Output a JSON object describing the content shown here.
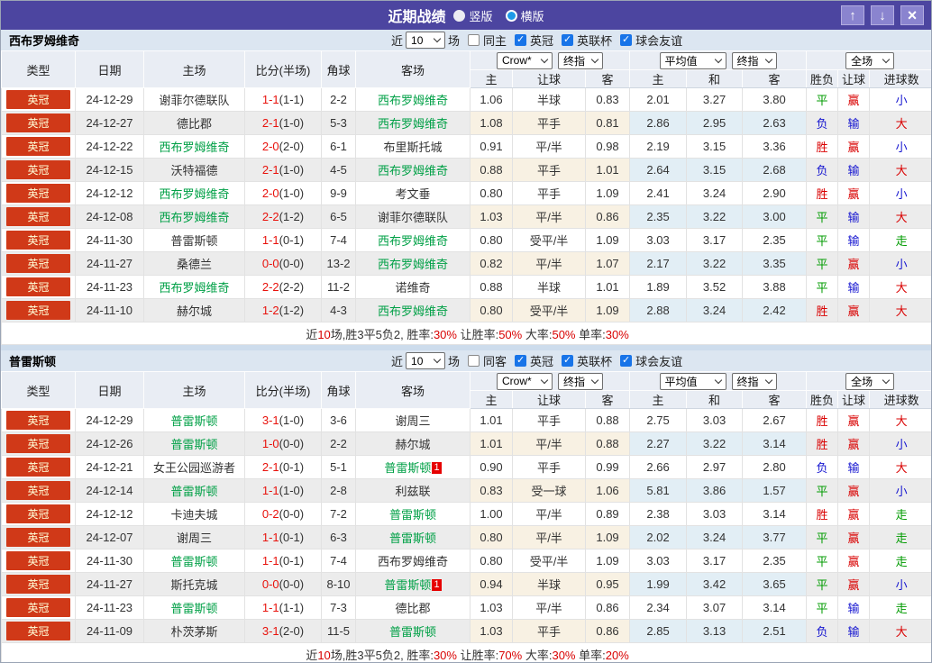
{
  "colors": {
    "titlebar": "#4c45a0",
    "league_badge_bg": "#d03918",
    "self_team_green": "#00a046",
    "score_red": "#e8120c",
    "win_red": "#d90000",
    "draw_green": "#009b00",
    "lose_blue": "#1515d0"
  },
  "titlebar": {
    "title": "近期战绩",
    "radio_vertical": "竖版",
    "radio_horizontal": "横版",
    "up_button": "↑",
    "down_button": "↓",
    "close_button": "×"
  },
  "cols": {
    "type": "类型",
    "date": "日期",
    "home": "主场",
    "score": "比分(半场)",
    "corner": "角球",
    "away": "客场",
    "h": "主",
    "handicap": "让球",
    "a": "客",
    "avg_h": "主",
    "avg_d": "和",
    "avg_a": "客",
    "outcome": "胜负",
    "asian": "让球",
    "goals": "进球数"
  },
  "selects": {
    "company": "Crow*",
    "final": "终指",
    "avg": "平均值",
    "final2": "终指",
    "scope": "全场"
  },
  "sections": [
    {
      "team": "西布罗姆维奇",
      "filter": {
        "near": "近",
        "games": "10",
        "games_suffix": "场",
        "same_label": "同主",
        "leagues": [
          "英冠",
          "英联杯",
          "球会友谊"
        ],
        "check_glyph": "✓"
      },
      "rows": [
        {
          "league": "英冠",
          "date": "24-12-29",
          "home": "谢菲尔德联队",
          "home_self": false,
          "score": "1-1",
          "half": "(1-1)",
          "corners": "2-2",
          "away": "西布罗姆维奇",
          "away_self": true,
          "away_badge": "",
          "crow": [
            "1.06",
            "半球",
            "0.83"
          ],
          "avg": [
            "2.01",
            "3.27",
            "3.80"
          ],
          "results": [
            {
              "t": "平",
              "c": "g"
            },
            {
              "t": "赢",
              "c": "r"
            },
            {
              "t": "小",
              "c": "b"
            }
          ]
        },
        {
          "league": "英冠",
          "date": "24-12-27",
          "home": "德比郡",
          "home_self": false,
          "score": "2-1",
          "half": "(1-0)",
          "corners": "5-3",
          "away": "西布罗姆维奇",
          "away_self": true,
          "away_badge": "",
          "crow": [
            "1.08",
            "平手",
            "0.81"
          ],
          "avg": [
            "2.86",
            "2.95",
            "2.63"
          ],
          "results": [
            {
              "t": "负",
              "c": "b"
            },
            {
              "t": "输",
              "c": "b"
            },
            {
              "t": "大",
              "c": "r"
            }
          ]
        },
        {
          "league": "英冠",
          "date": "24-12-22",
          "home": "西布罗姆维奇",
          "home_self": true,
          "score": "2-0",
          "half": "(2-0)",
          "corners": "6-1",
          "away": "布里斯托城",
          "away_self": false,
          "away_badge": "",
          "crow": [
            "0.91",
            "平/半",
            "0.98"
          ],
          "avg": [
            "2.19",
            "3.15",
            "3.36"
          ],
          "results": [
            {
              "t": "胜",
              "c": "r"
            },
            {
              "t": "赢",
              "c": "r"
            },
            {
              "t": "小",
              "c": "b"
            }
          ]
        },
        {
          "league": "英冠",
          "date": "24-12-15",
          "home": "沃特福德",
          "home_self": false,
          "score": "2-1",
          "half": "(1-0)",
          "corners": "4-5",
          "away": "西布罗姆维奇",
          "away_self": true,
          "away_badge": "",
          "crow": [
            "0.88",
            "平手",
            "1.01"
          ],
          "avg": [
            "2.64",
            "3.15",
            "2.68"
          ],
          "results": [
            {
              "t": "负",
              "c": "b"
            },
            {
              "t": "输",
              "c": "b"
            },
            {
              "t": "大",
              "c": "r"
            }
          ]
        },
        {
          "league": "英冠",
          "date": "24-12-12",
          "home": "西布罗姆维奇",
          "home_self": true,
          "score": "2-0",
          "half": "(1-0)",
          "corners": "9-9",
          "away": "考文垂",
          "away_self": false,
          "away_badge": "",
          "crow": [
            "0.80",
            "平手",
            "1.09"
          ],
          "avg": [
            "2.41",
            "3.24",
            "2.90"
          ],
          "results": [
            {
              "t": "胜",
              "c": "r"
            },
            {
              "t": "赢",
              "c": "r"
            },
            {
              "t": "小",
              "c": "b"
            }
          ]
        },
        {
          "league": "英冠",
          "date": "24-12-08",
          "home": "西布罗姆维奇",
          "home_self": true,
          "score": "2-2",
          "half": "(1-2)",
          "corners": "6-5",
          "away": "谢菲尔德联队",
          "away_self": false,
          "away_badge": "",
          "crow": [
            "1.03",
            "平/半",
            "0.86"
          ],
          "avg": [
            "2.35",
            "3.22",
            "3.00"
          ],
          "results": [
            {
              "t": "平",
              "c": "g"
            },
            {
              "t": "输",
              "c": "b"
            },
            {
              "t": "大",
              "c": "r"
            }
          ]
        },
        {
          "league": "英冠",
          "date": "24-11-30",
          "home": "普雷斯顿",
          "home_self": false,
          "score": "1-1",
          "half": "(0-1)",
          "corners": "7-4",
          "away": "西布罗姆维奇",
          "away_self": true,
          "away_badge": "",
          "crow": [
            "0.80",
            "受平/半",
            "1.09"
          ],
          "avg": [
            "3.03",
            "3.17",
            "2.35"
          ],
          "results": [
            {
              "t": "平",
              "c": "g"
            },
            {
              "t": "输",
              "c": "b"
            },
            {
              "t": "走",
              "c": "g"
            }
          ]
        },
        {
          "league": "英冠",
          "date": "24-11-27",
          "home": "桑德兰",
          "home_self": false,
          "score": "0-0",
          "half": "(0-0)",
          "corners": "13-2",
          "away": "西布罗姆维奇",
          "away_self": true,
          "away_badge": "",
          "crow": [
            "0.82",
            "平/半",
            "1.07"
          ],
          "avg": [
            "2.17",
            "3.22",
            "3.35"
          ],
          "results": [
            {
              "t": "平",
              "c": "g"
            },
            {
              "t": "赢",
              "c": "r"
            },
            {
              "t": "小",
              "c": "b"
            }
          ]
        },
        {
          "league": "英冠",
          "date": "24-11-23",
          "home": "西布罗姆维奇",
          "home_self": true,
          "score": "2-2",
          "half": "(2-2)",
          "corners": "11-2",
          "away": "诺维奇",
          "away_self": false,
          "away_badge": "",
          "crow": [
            "0.88",
            "半球",
            "1.01"
          ],
          "avg": [
            "1.89",
            "3.52",
            "3.88"
          ],
          "results": [
            {
              "t": "平",
              "c": "g"
            },
            {
              "t": "输",
              "c": "b"
            },
            {
              "t": "大",
              "c": "r"
            }
          ]
        },
        {
          "league": "英冠",
          "date": "24-11-10",
          "home": "赫尔城",
          "home_self": false,
          "score": "1-2",
          "half": "(1-2)",
          "corners": "4-3",
          "away": "西布罗姆维奇",
          "away_self": true,
          "away_badge": "",
          "crow": [
            "0.80",
            "受平/半",
            "1.09"
          ],
          "avg": [
            "2.88",
            "3.24",
            "2.42"
          ],
          "results": [
            {
              "t": "胜",
              "c": "r"
            },
            {
              "t": "赢",
              "c": "r"
            },
            {
              "t": "大",
              "c": "r"
            }
          ]
        }
      ],
      "summary": [
        {
          "t": "近"
        },
        {
          "t": "10",
          "c": "r"
        },
        {
          "t": "场,胜3平5负2, 胜率:"
        },
        {
          "t": "30%",
          "c": "r"
        },
        {
          "t": " 让胜率:"
        },
        {
          "t": "50%",
          "c": "r"
        },
        {
          "t": " 大率:"
        },
        {
          "t": "50%",
          "c": "r"
        },
        {
          "t": " 单率:"
        },
        {
          "t": "30%",
          "c": "r"
        }
      ]
    },
    {
      "team": "普雷斯顿",
      "filter": {
        "near": "近",
        "games": "10",
        "games_suffix": "场",
        "same_label": "同客",
        "leagues": [
          "英冠",
          "英联杯",
          "球会友谊"
        ],
        "check_glyph": "✓"
      },
      "rows": [
        {
          "league": "英冠",
          "date": "24-12-29",
          "home": "普雷斯顿",
          "home_self": true,
          "score": "3-1",
          "half": "(1-0)",
          "corners": "3-6",
          "away": "谢周三",
          "away_self": false,
          "away_badge": "",
          "crow": [
            "1.01",
            "平手",
            "0.88"
          ],
          "avg": [
            "2.75",
            "3.03",
            "2.67"
          ],
          "results": [
            {
              "t": "胜",
              "c": "r"
            },
            {
              "t": "赢",
              "c": "r"
            },
            {
              "t": "大",
              "c": "r"
            }
          ]
        },
        {
          "league": "英冠",
          "date": "24-12-26",
          "home": "普雷斯顿",
          "home_self": true,
          "score": "1-0",
          "half": "(0-0)",
          "corners": "2-2",
          "away": "赫尔城",
          "away_self": false,
          "away_badge": "",
          "crow": [
            "1.01",
            "平/半",
            "0.88"
          ],
          "avg": [
            "2.27",
            "3.22",
            "3.14"
          ],
          "results": [
            {
              "t": "胜",
              "c": "r"
            },
            {
              "t": "赢",
              "c": "r"
            },
            {
              "t": "小",
              "c": "b"
            }
          ]
        },
        {
          "league": "英冠",
          "date": "24-12-21",
          "home": "女王公园巡游者",
          "home_self": false,
          "score": "2-1",
          "half": "(0-1)",
          "corners": "5-1",
          "away": "普雷斯顿",
          "away_self": true,
          "away_badge": "1",
          "crow": [
            "0.90",
            "平手",
            "0.99"
          ],
          "avg": [
            "2.66",
            "2.97",
            "2.80"
          ],
          "results": [
            {
              "t": "负",
              "c": "b"
            },
            {
              "t": "输",
              "c": "b"
            },
            {
              "t": "大",
              "c": "r"
            }
          ]
        },
        {
          "league": "英冠",
          "date": "24-12-14",
          "home": "普雷斯顿",
          "home_self": true,
          "score": "1-1",
          "half": "(1-0)",
          "corners": "2-8",
          "away": "利兹联",
          "away_self": false,
          "away_badge": "",
          "crow": [
            "0.83",
            "受一球",
            "1.06"
          ],
          "avg": [
            "5.81",
            "3.86",
            "1.57"
          ],
          "results": [
            {
              "t": "平",
              "c": "g"
            },
            {
              "t": "赢",
              "c": "r"
            },
            {
              "t": "小",
              "c": "b"
            }
          ]
        },
        {
          "league": "英冠",
          "date": "24-12-12",
          "home": "卡迪夫城",
          "home_self": false,
          "score": "0-2",
          "half": "(0-0)",
          "corners": "7-2",
          "away": "普雷斯顿",
          "away_self": true,
          "away_badge": "",
          "crow": [
            "1.00",
            "平/半",
            "0.89"
          ],
          "avg": [
            "2.38",
            "3.03",
            "3.14"
          ],
          "results": [
            {
              "t": "胜",
              "c": "r"
            },
            {
              "t": "赢",
              "c": "r"
            },
            {
              "t": "走",
              "c": "g"
            }
          ]
        },
        {
          "league": "英冠",
          "date": "24-12-07",
          "home": "谢周三",
          "home_self": false,
          "score": "1-1",
          "half": "(0-1)",
          "corners": "6-3",
          "away": "普雷斯顿",
          "away_self": true,
          "away_badge": "",
          "crow": [
            "0.80",
            "平/半",
            "1.09"
          ],
          "avg": [
            "2.02",
            "3.24",
            "3.77"
          ],
          "results": [
            {
              "t": "平",
              "c": "g"
            },
            {
              "t": "赢",
              "c": "r"
            },
            {
              "t": "走",
              "c": "g"
            }
          ]
        },
        {
          "league": "英冠",
          "date": "24-11-30",
          "home": "普雷斯顿",
          "home_self": true,
          "score": "1-1",
          "half": "(0-1)",
          "corners": "7-4",
          "away": "西布罗姆维奇",
          "away_self": false,
          "away_badge": "",
          "crow": [
            "0.80",
            "受平/半",
            "1.09"
          ],
          "avg": [
            "3.03",
            "3.17",
            "2.35"
          ],
          "results": [
            {
              "t": "平",
              "c": "g"
            },
            {
              "t": "赢",
              "c": "r"
            },
            {
              "t": "走",
              "c": "g"
            }
          ]
        },
        {
          "league": "英冠",
          "date": "24-11-27",
          "home": "斯托克城",
          "home_self": false,
          "score": "0-0",
          "half": "(0-0)",
          "corners": "8-10",
          "away": "普雷斯顿",
          "away_self": true,
          "away_badge": "1",
          "crow": [
            "0.94",
            "半球",
            "0.95"
          ],
          "avg": [
            "1.99",
            "3.42",
            "3.65"
          ],
          "results": [
            {
              "t": "平",
              "c": "g"
            },
            {
              "t": "赢",
              "c": "r"
            },
            {
              "t": "小",
              "c": "b"
            }
          ]
        },
        {
          "league": "英冠",
          "date": "24-11-23",
          "home": "普雷斯顿",
          "home_self": true,
          "score": "1-1",
          "half": "(1-1)",
          "corners": "7-3",
          "away": "德比郡",
          "away_self": false,
          "away_badge": "",
          "crow": [
            "1.03",
            "平/半",
            "0.86"
          ],
          "avg": [
            "2.34",
            "3.07",
            "3.14"
          ],
          "results": [
            {
              "t": "平",
              "c": "g"
            },
            {
              "t": "输",
              "c": "b"
            },
            {
              "t": "走",
              "c": "g"
            }
          ]
        },
        {
          "league": "英冠",
          "date": "24-11-09",
          "home": "朴茨茅斯",
          "home_self": false,
          "score": "3-1",
          "half": "(2-0)",
          "corners": "11-5",
          "away": "普雷斯顿",
          "away_self": true,
          "away_badge": "",
          "crow": [
            "1.03",
            "平手",
            "0.86"
          ],
          "avg": [
            "2.85",
            "3.13",
            "2.51"
          ],
          "results": [
            {
              "t": "负",
              "c": "b"
            },
            {
              "t": "输",
              "c": "b"
            },
            {
              "t": "大",
              "c": "r"
            }
          ]
        }
      ],
      "summary": [
        {
          "t": "近"
        },
        {
          "t": "10",
          "c": "r"
        },
        {
          "t": "场,胜3平5负2, 胜率:"
        },
        {
          "t": "30%",
          "c": "r"
        },
        {
          "t": " 让胜率:"
        },
        {
          "t": "70%",
          "c": "r"
        },
        {
          "t": " 大率:"
        },
        {
          "t": "30%",
          "c": "r"
        },
        {
          "t": " 单率:"
        },
        {
          "t": "20%",
          "c": "r"
        }
      ]
    }
  ]
}
